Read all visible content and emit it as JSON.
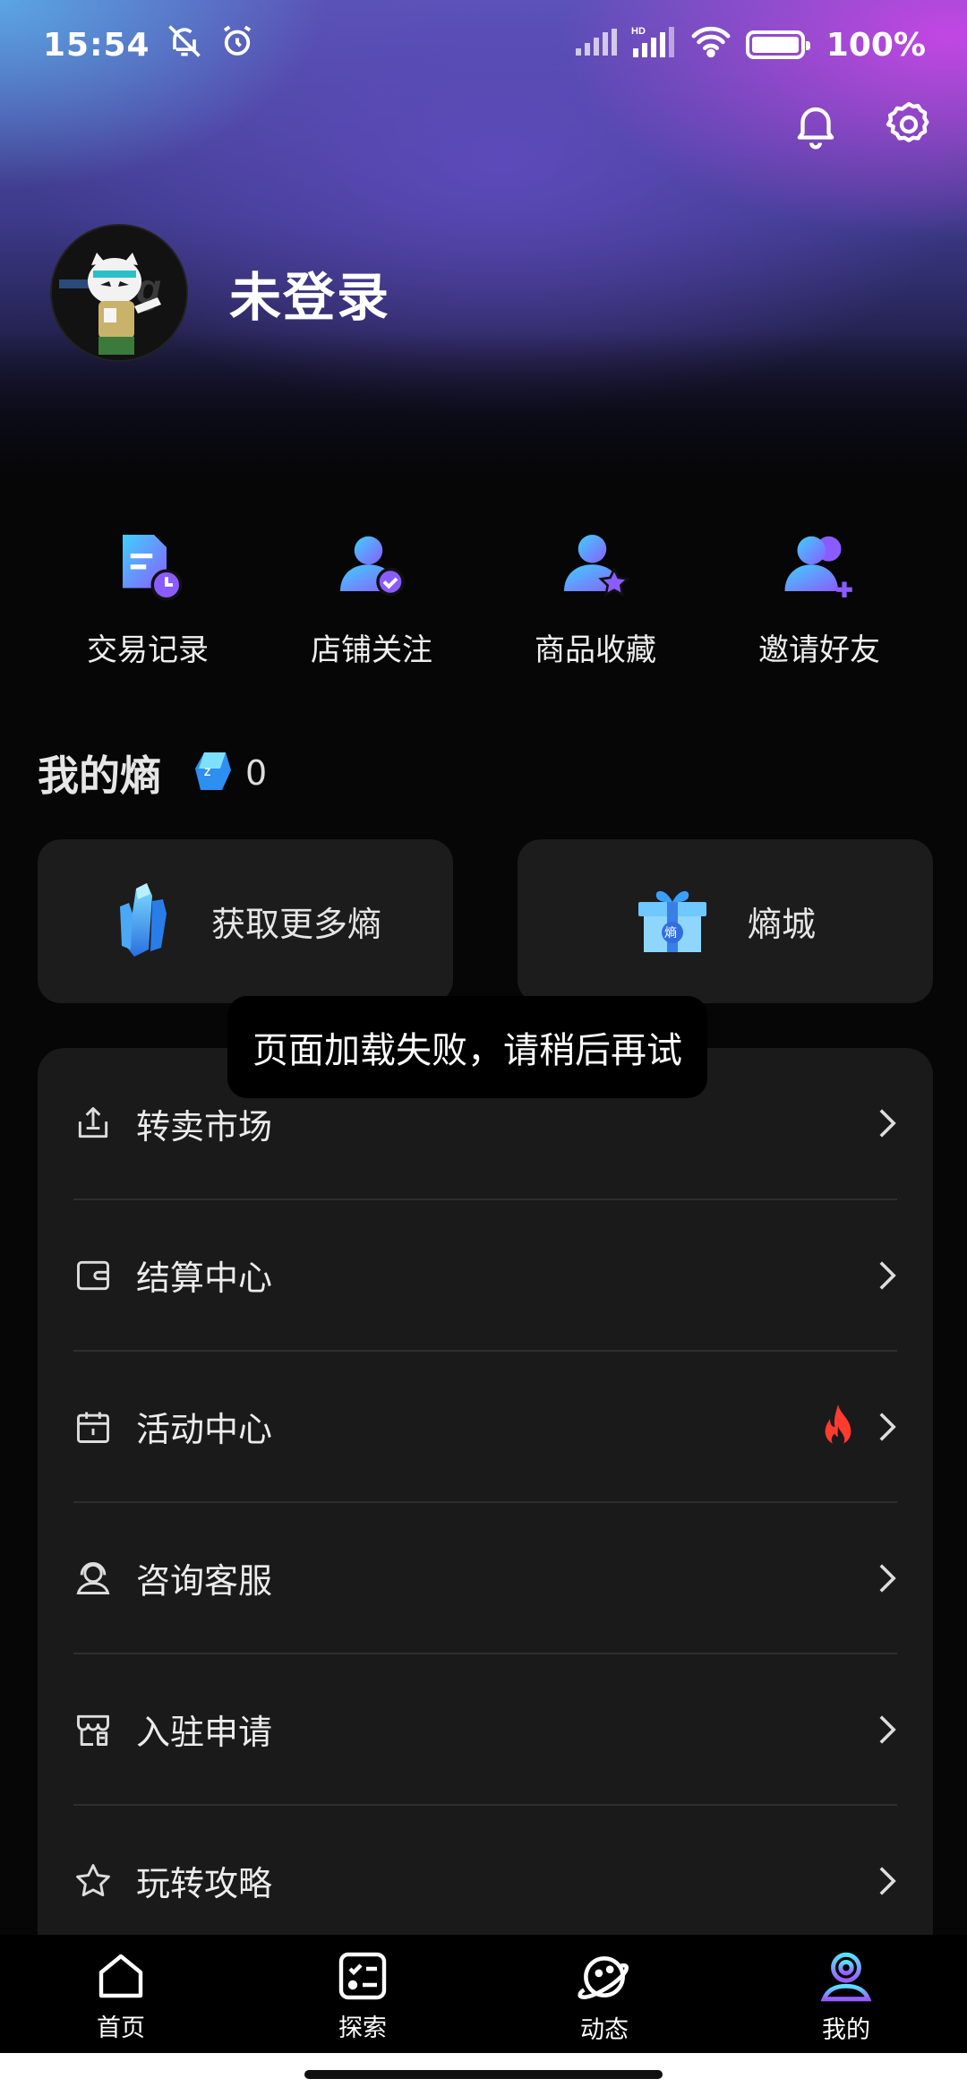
{
  "status_bar": {
    "time": "15:54",
    "battery": "100%"
  },
  "header": {
    "notification_icon": "bell-icon",
    "settings_icon": "gear-icon",
    "profile_name": "未登录"
  },
  "quick_actions": [
    {
      "label": "交易记录",
      "icon": "transaction-record-icon"
    },
    {
      "label": "店铺关注",
      "icon": "shop-follow-icon"
    },
    {
      "label": "商品收藏",
      "icon": "product-favorite-icon"
    },
    {
      "label": "邀请好友",
      "icon": "invite-friends-icon"
    }
  ],
  "entropy": {
    "title": "我的熵",
    "count": "0",
    "cards": [
      {
        "label": "获取更多熵",
        "icon": "crystal-icon"
      },
      {
        "label": "熵城",
        "icon": "gift-box-icon"
      }
    ]
  },
  "menu": [
    {
      "label": "转卖市场",
      "icon": "upload-icon"
    },
    {
      "label": "结算中心",
      "icon": "wallet-icon"
    },
    {
      "label": "活动中心",
      "icon": "calendar-icon",
      "badge": "fire-icon"
    },
    {
      "label": "咨询客服",
      "icon": "customer-service-icon"
    },
    {
      "label": "入驻申请",
      "icon": "store-application-icon"
    },
    {
      "label": "玩转攻略",
      "icon": "star-icon"
    }
  ],
  "toast": "页面加载失败，请稍后再试",
  "bottom_nav": [
    {
      "label": "首页",
      "icon": "home-icon"
    },
    {
      "label": "探索",
      "icon": "explore-icon"
    },
    {
      "label": "动态",
      "icon": "planet-icon"
    },
    {
      "label": "我的",
      "icon": "profile-icon",
      "active": true
    }
  ],
  "colors": {
    "accent_gradient_start": "#3fd0ff",
    "accent_gradient_end": "#8a5cff",
    "card_bg": "#1c1c1c",
    "fire": "#ff3b2f"
  }
}
